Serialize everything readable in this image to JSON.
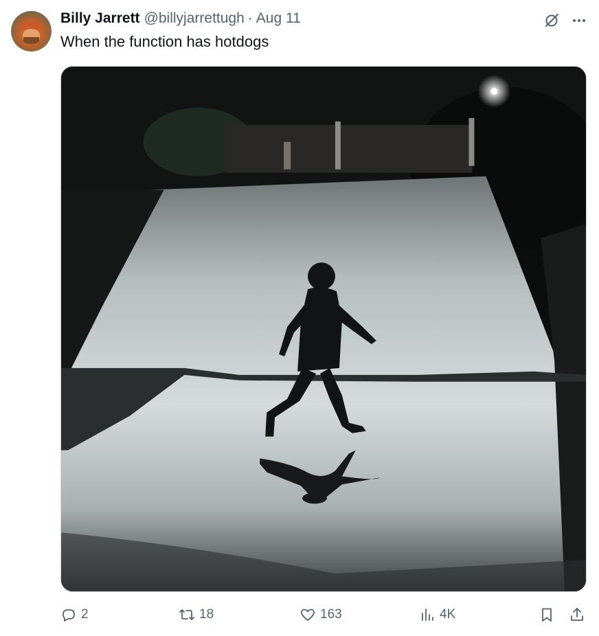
{
  "tweet": {
    "author_name": "Billy Jarrett",
    "handle": "@billyjarrettugh",
    "separator": "·",
    "date": "Aug 11",
    "text": "When the function has hotdogs"
  },
  "media": {
    "description_icon": "photo"
  },
  "actions": {
    "replies": "2",
    "retweets": "18",
    "likes": "163",
    "views": "4K"
  },
  "icons": {
    "grok": "grok-icon",
    "more": "more-icon",
    "reply": "reply-icon",
    "retweet": "retweet-icon",
    "like": "heart-icon",
    "views": "views-icon",
    "bookmark": "bookmark-icon",
    "share": "share-icon"
  },
  "colors": {
    "text_primary": "#0f1419",
    "text_secondary": "#536471",
    "border": "#cfd9de"
  }
}
